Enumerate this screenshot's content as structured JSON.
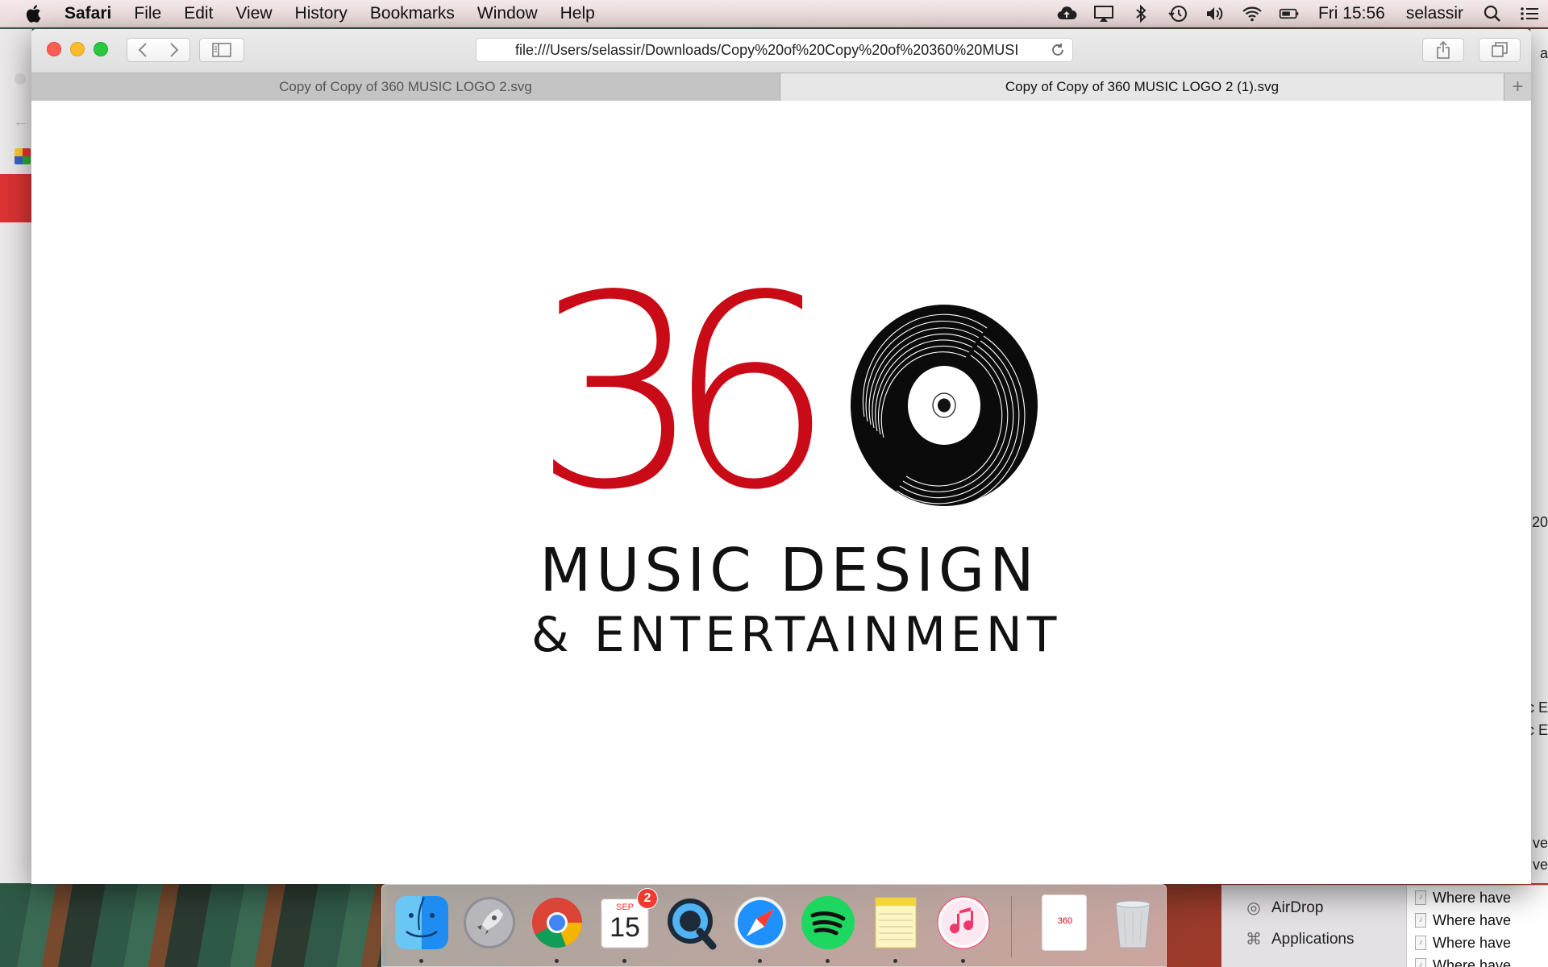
{
  "menubar": {
    "app_name": "Safari",
    "items": [
      "File",
      "Edit",
      "View",
      "History",
      "Bookmarks",
      "Window",
      "Help"
    ],
    "clock": "Fri 15:56",
    "user": "selassir"
  },
  "window": {
    "address": "file:///Users/selassir/Downloads/Copy%20of%20Copy%20of%20360%20MUSI",
    "tabs": [
      {
        "title": "Copy of Copy of 360 MUSIC LOGO 2.svg",
        "active": false
      },
      {
        "title": "Copy of Copy of 360 MUSIC LOGO 2 (1).svg",
        "active": true
      }
    ]
  },
  "logo": {
    "digit_3": "3",
    "digit_6": "6",
    "line1": "MUSIC DESIGN",
    "line2": "& ENTERTAINMENT",
    "red": "#c90a17",
    "black": "#111111"
  },
  "dock": {
    "calendar_month": "SEP",
    "calendar_day": "15",
    "calendar_badge": "2",
    "apps": [
      "finder-icon",
      "launchpad-icon",
      "chrome-icon",
      "calendar-icon",
      "quicktime-icon",
      "safari-icon",
      "spotify-icon",
      "notes-icon",
      "itunes-icon",
      "document-thumbnail-icon",
      "trash-icon"
    ]
  },
  "finder": {
    "sidebar": [
      "AirDrop",
      "Applications"
    ],
    "rows": [
      "Where have",
      "Where have",
      "Where have",
      "Where have"
    ]
  },
  "background_fragments": [
    "a",
    "20",
    "c E",
    "c E",
    "ve",
    "ve"
  ],
  "thumbnail_text": "360"
}
